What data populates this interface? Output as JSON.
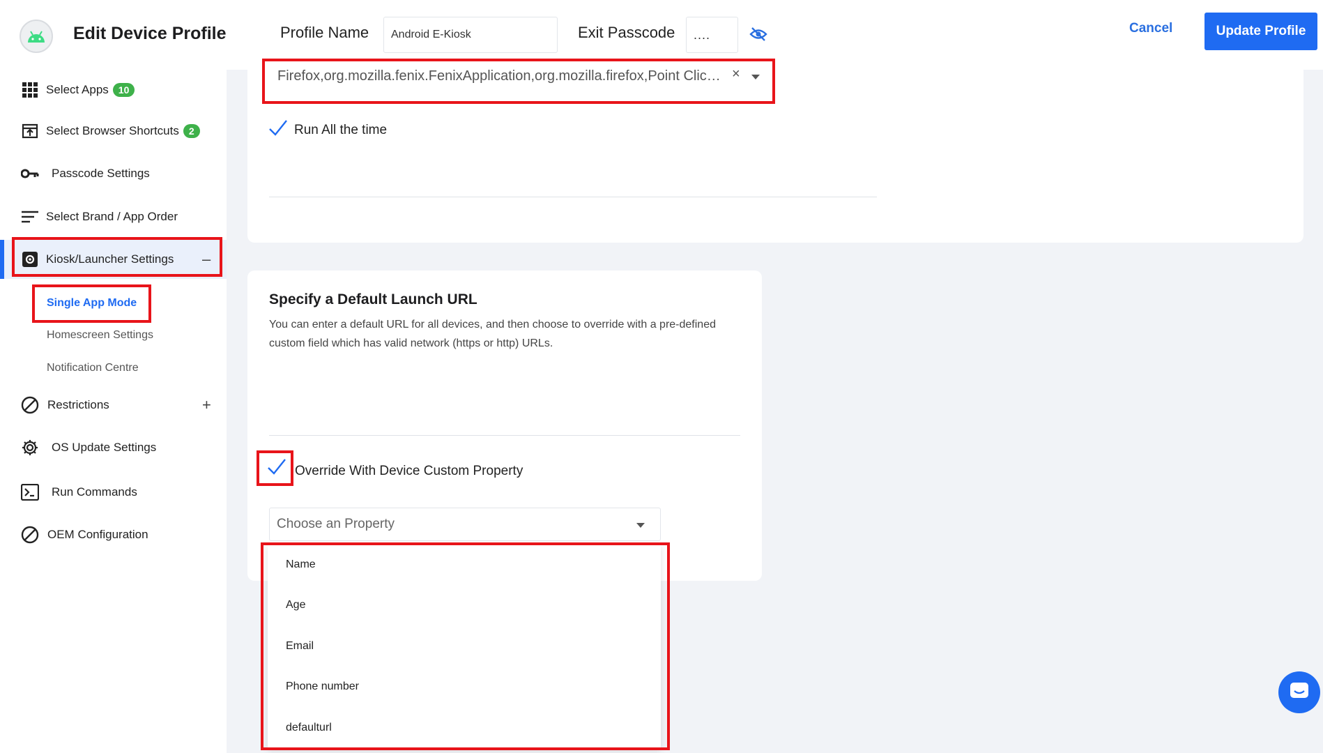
{
  "header": {
    "title": "Edit Device Profile",
    "profile_name_label": "Profile Name",
    "profile_name_value": "Android E-Kiosk",
    "exit_passcode_label": "Exit Passcode",
    "exit_passcode_value": "....",
    "cancel_label": "Cancel",
    "update_label": "Update Profile"
  },
  "sidebar": {
    "items": [
      {
        "label": "Select Apps",
        "badge": "10",
        "icon": "grid-icon"
      },
      {
        "label": "Select Browser Shortcuts",
        "badge": "2",
        "icon": "shortcut-icon"
      },
      {
        "label": "Passcode Settings",
        "icon": "key-icon"
      },
      {
        "label": "Select Brand / App Order",
        "icon": "sort-icon"
      },
      {
        "label": "Kiosk/Launcher Settings",
        "icon": "gear-box-icon",
        "toggle": "–"
      },
      {
        "label": "Restrictions",
        "icon": "block-icon",
        "toggle": "+"
      },
      {
        "label": "OS Update Settings",
        "icon": "gear-icon"
      },
      {
        "label": "Run Commands",
        "icon": "terminal-icon"
      },
      {
        "label": "OEM Configuration",
        "icon": "block-icon"
      }
    ],
    "sub_items": [
      "Single App Mode",
      "Homescreen Settings",
      "Notification Centre"
    ]
  },
  "kiosk": {
    "apps_value": "Firefox,org.mozilla.fenix.FenixApplication,org.mozilla.firefox,Point Click ...",
    "clear_symbol": "×",
    "run_all_label": "Run All the time"
  },
  "launch_url": {
    "title": "Specify a Default Launch URL",
    "description": "You can enter a default URL for all devices, and then choose to override with a pre-defined custom field which has valid network (https or http) URLs.",
    "override_label": "Override With Device Custom Property",
    "property_placeholder": "Choose an Property",
    "options": [
      "Name",
      "Age",
      "Email",
      "Phone number",
      "defaulturl"
    ]
  },
  "colors": {
    "accent": "#1f6bf2",
    "badge": "#3eb14a",
    "highlight": "#e8141a"
  }
}
